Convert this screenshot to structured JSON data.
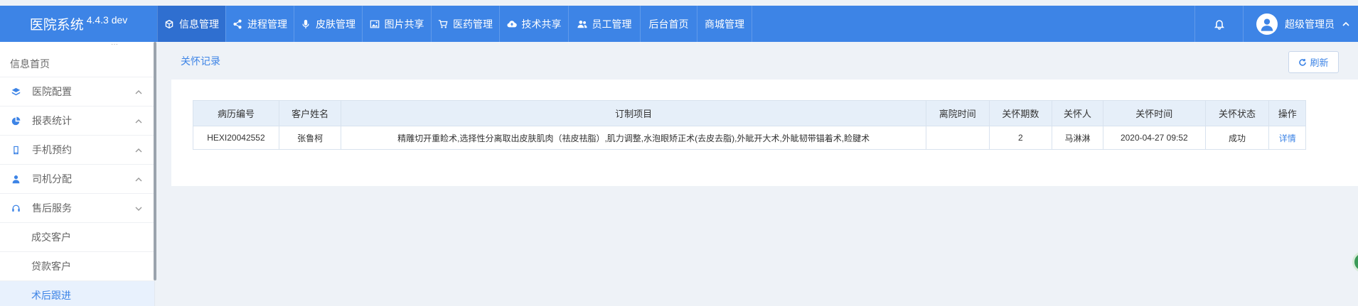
{
  "brand": {
    "name": "医院系统",
    "version": "4.4.3 dev"
  },
  "nav": [
    {
      "label": "信息管理",
      "icon": "cube-icon"
    },
    {
      "label": "进程管理",
      "icon": "share-icon"
    },
    {
      "label": "皮肤管理",
      "icon": "microphone-icon"
    },
    {
      "label": "图片共享",
      "icon": "image-icon"
    },
    {
      "label": "医药管理",
      "icon": "cart-icon"
    },
    {
      "label": "技术共享",
      "icon": "cloud-upload-icon"
    },
    {
      "label": "员工管理",
      "icon": "users-icon"
    },
    {
      "label": "后台首页"
    },
    {
      "label": "商城管理"
    }
  ],
  "user": {
    "name": "超级管理员"
  },
  "sidebar": {
    "home": "信息首页",
    "items": [
      {
        "label": "医院配置",
        "icon": "layers-icon",
        "expanded": false
      },
      {
        "label": "报表统计",
        "icon": "pie-chart-icon",
        "expanded": false
      },
      {
        "label": "手机预约",
        "icon": "mobile-icon",
        "expanded": false
      },
      {
        "label": "司机分配",
        "icon": "user-icon",
        "expanded": false
      },
      {
        "label": "售后服务",
        "icon": "headset-icon",
        "expanded": true
      }
    ],
    "sub_items": [
      {
        "label": "成交客户"
      },
      {
        "label": "贷款客户"
      },
      {
        "label": "术后跟进",
        "active": true
      }
    ]
  },
  "main": {
    "title": "关怀记录",
    "refresh_label": "刷新",
    "table": {
      "columns": [
        "病历编号",
        "客户姓名",
        "订制项目",
        "离院时间",
        "关怀期数",
        "关怀人",
        "关怀时间",
        "关怀状态",
        "操作"
      ],
      "rows": [
        [
          "HEXI20042552",
          "张鲁柯",
          "精雕切开重睑术,选择性分离取出皮肤肌肉（祛皮祛脂）,肌力调整,水泡眼矫正术(去皮去脂),外眦开大术,外眦韧带锚着术,睑腱术",
          "",
          "2",
          "马淋淋",
          "2020-04-27 09:52",
          "成功",
          "详情"
        ]
      ]
    }
  },
  "colors": {
    "primary": "#3d84e6",
    "active_nav": "#2f6fd0",
    "page_bg": "#eef2f7",
    "table_header": "#e6eff9"
  }
}
